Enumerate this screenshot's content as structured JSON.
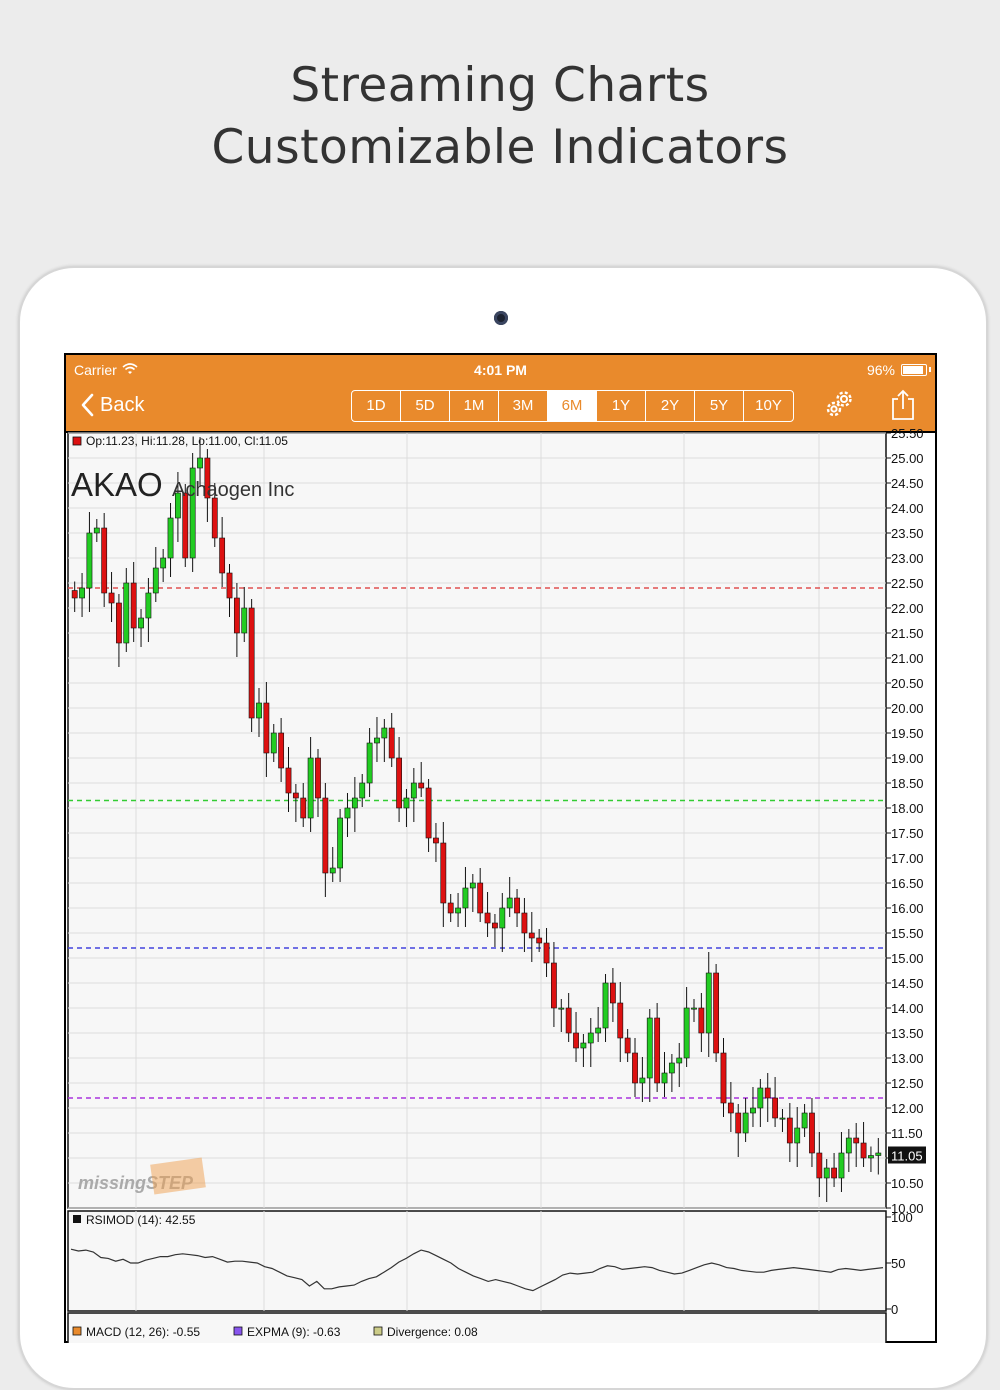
{
  "headline": {
    "line1": "Streaming Charts",
    "line2": "Customizable Indicators"
  },
  "status_bar": {
    "carrier": "Carrier",
    "time": "4:01 PM",
    "battery": "96%"
  },
  "nav": {
    "back_label": "Back",
    "ranges": [
      "1D",
      "5D",
      "1M",
      "3M",
      "6M",
      "1Y",
      "2Y",
      "5Y",
      "10Y"
    ],
    "active_range": "6M",
    "accent_color": "#e98a2c",
    "icons": [
      "back-chevron-icon",
      "gear-icon",
      "share-icon"
    ]
  },
  "chart_data": [
    {
      "type": "candlestick",
      "ticker": "AKAO",
      "company": "Achaogen Inc",
      "ohlc_label": "Op:11.23, Hi:11.28, Lo:11.00, Cl:11.05",
      "last_price": "11.05",
      "ylim": [
        10.0,
        25.5
      ],
      "yticks": [
        "25.50",
        "25.00",
        "24.50",
        "24.00",
        "23.50",
        "23.00",
        "22.50",
        "22.00",
        "21.50",
        "21.00",
        "20.50",
        "20.00",
        "19.50",
        "19.00",
        "18.50",
        "18.00",
        "17.50",
        "17.00",
        "16.50",
        "16.00",
        "15.50",
        "15.00",
        "14.50",
        "14.00",
        "13.50",
        "13.00",
        "12.50",
        "12.00",
        "11.50",
        "11.00",
        "10.50",
        "10.00"
      ],
      "grid": true,
      "up_color": "#22cc22",
      "down_color": "#dd1111",
      "levels": [
        {
          "value": 22.4,
          "color": "#e05050"
        },
        {
          "value": 18.15,
          "color": "#33cc33"
        },
        {
          "value": 15.2,
          "color": "#4444dd"
        },
        {
          "value": 12.2,
          "color": "#aa33dd"
        }
      ],
      "close": [
        22.2,
        22.4,
        23.5,
        23.6,
        22.3,
        22.1,
        21.3,
        22.5,
        21.6,
        21.8,
        22.3,
        22.8,
        23.0,
        23.8,
        24.3,
        23.0,
        24.8,
        25.0,
        24.2,
        23.4,
        22.7,
        22.2,
        21.5,
        22.0,
        19.8,
        20.1,
        19.1,
        19.5,
        18.8,
        18.3,
        18.2,
        17.8,
        19.0,
        18.2,
        16.7,
        16.8,
        17.8,
        18.0,
        18.2,
        18.5,
        19.3,
        19.4,
        19.6,
        19.0,
        18.0,
        18.2,
        18.5,
        18.4,
        17.4,
        17.3,
        16.1,
        15.9,
        16.0,
        16.4,
        16.5,
        15.9,
        15.7,
        15.6,
        16.0,
        16.2,
        15.9,
        15.5,
        15.4,
        15.3,
        14.9,
        14.0,
        14.0,
        13.5,
        13.2,
        13.3,
        13.5,
        13.6,
        14.5,
        14.1,
        13.4,
        13.1,
        12.5,
        12.6,
        13.8,
        12.5,
        12.7,
        12.9,
        13.0,
        14.0,
        14.0,
        13.5,
        14.7,
        13.1,
        12.1,
        11.9,
        11.5,
        11.9,
        12.0,
        12.4,
        12.2,
        11.8,
        11.8,
        11.3,
        11.6,
        11.9,
        11.1,
        10.6,
        10.8,
        10.6,
        11.1,
        11.4,
        11.3,
        11.0,
        11.05,
        11.1
      ],
      "watermark": "missingSTEP"
    },
    {
      "type": "line",
      "label": "RSIMOD (14): 42.55",
      "ylim": [
        0,
        100
      ],
      "yticks": [
        "100",
        "50",
        "0"
      ],
      "line_color": "#333333",
      "values": [
        65,
        63,
        64,
        62,
        56,
        55,
        52,
        54,
        50,
        50,
        53,
        55,
        57,
        57,
        59,
        60,
        59,
        58,
        56,
        57,
        54,
        51,
        52,
        52,
        51,
        50,
        46,
        44,
        40,
        36,
        34,
        32,
        25,
        30,
        22,
        22,
        24,
        25,
        26,
        30,
        33,
        35,
        40,
        45,
        51,
        55,
        60,
        64,
        62,
        58,
        54,
        50,
        44,
        40,
        36,
        33,
        30,
        32,
        30,
        28,
        25,
        22,
        20,
        24,
        28,
        32,
        37,
        39,
        38,
        39,
        40,
        44,
        47,
        46,
        43,
        44,
        45,
        46,
        45,
        42,
        40,
        38,
        39,
        42,
        45,
        48,
        50,
        48,
        45,
        44,
        42,
        41,
        40,
        40,
        42,
        43,
        44,
        45,
        44,
        43,
        42,
        41,
        40,
        43,
        44,
        43,
        42,
        43,
        44,
        45
      ]
    }
  ],
  "macd_legend": {
    "macd": "MACD (12, 26): -0.55",
    "exp": "EXPMA (9): -0.63",
    "div": "Divergence: 0.08"
  }
}
